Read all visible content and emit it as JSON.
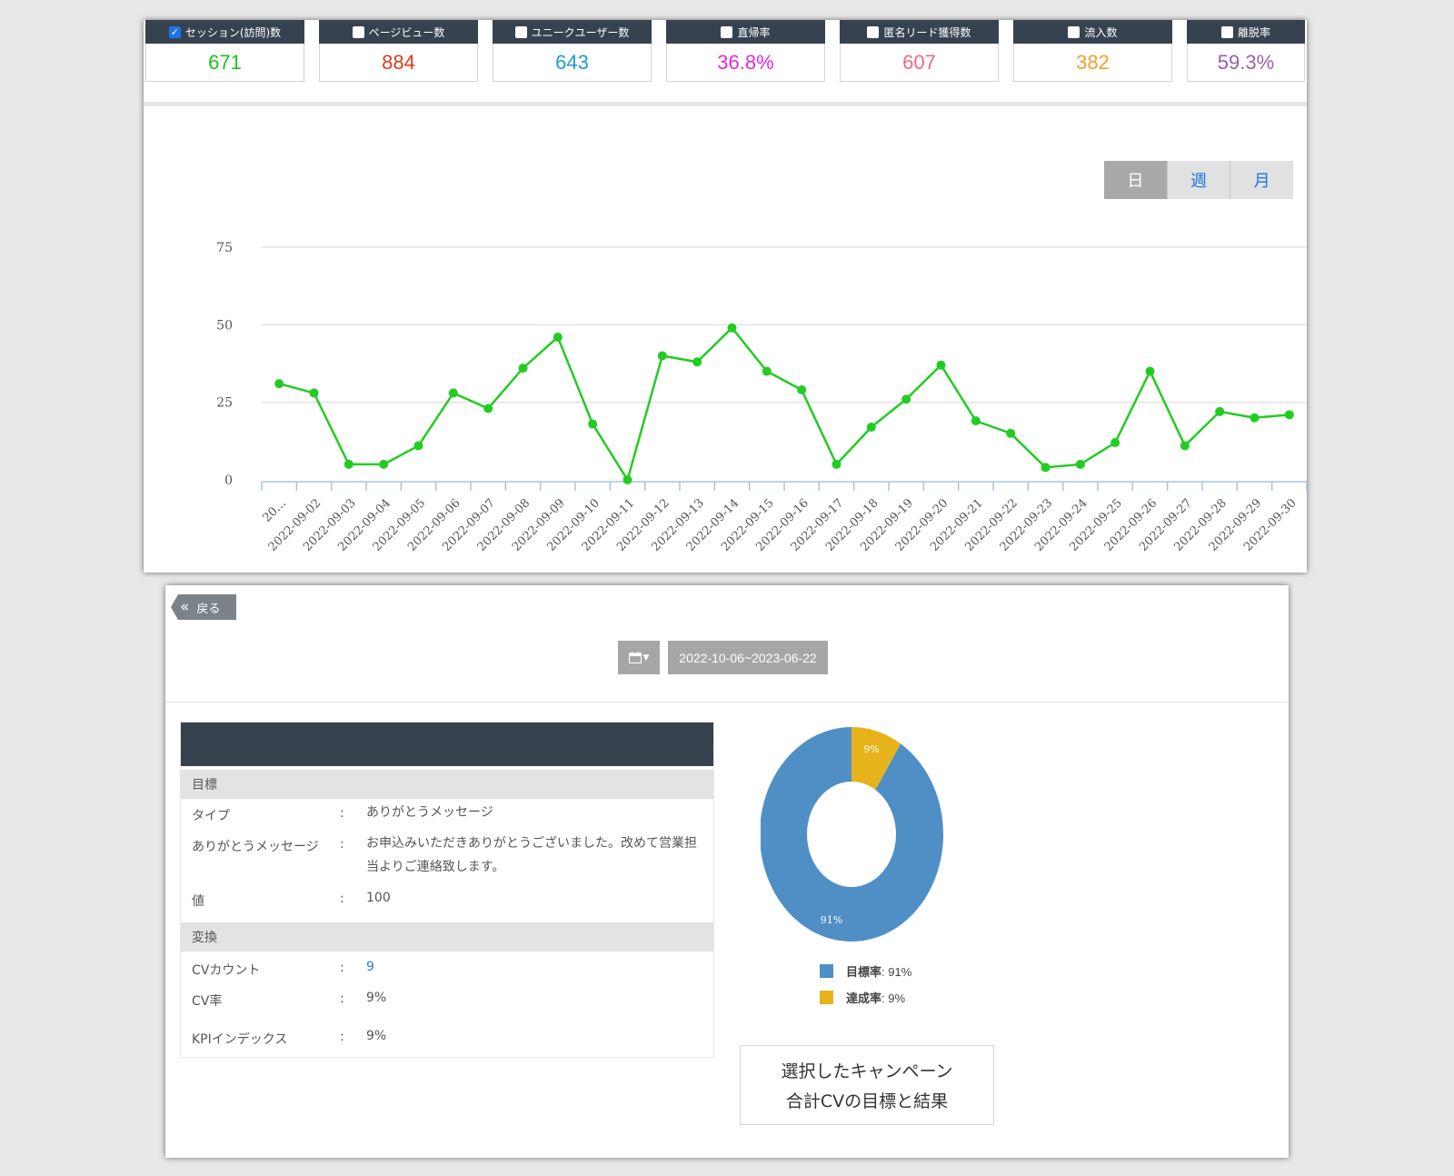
{
  "kpis": [
    {
      "label": "セッション(訪問)数",
      "value": "671",
      "color": "#22c01a",
      "checked": true
    },
    {
      "label": "ページビュー数",
      "value": "884",
      "color": "#e03a1e",
      "checked": false
    },
    {
      "label": "ユニークユーザー数",
      "value": "643",
      "color": "#1e9ad6",
      "checked": false
    },
    {
      "label": "直帰率",
      "value": "36.8%",
      "color": "#e52ad8",
      "checked": false
    },
    {
      "label": "匿名リード獲得数",
      "value": "607",
      "color": "#ee6a82",
      "checked": false
    },
    {
      "label": "流入数",
      "value": "382",
      "color": "#f2a028",
      "checked": false
    },
    {
      "label": "離脱率",
      "value": "59.3%",
      "color": "#9b5ea8",
      "checked": false
    }
  ],
  "period_toggle": {
    "day": "日",
    "week": "週",
    "month": "月"
  },
  "chart_data": {
    "type": "line",
    "x": [
      "20…",
      "2022-09-02",
      "2022-09-03",
      "2022-09-04",
      "2022-09-05",
      "2022-09-06",
      "2022-09-07",
      "2022-09-08",
      "2022-09-09",
      "2022-09-10",
      "2022-09-11",
      "2022-09-12",
      "2022-09-13",
      "2022-09-14",
      "2022-09-15",
      "2022-09-16",
      "2022-09-17",
      "2022-09-18",
      "2022-09-19",
      "2022-09-20",
      "2022-09-21",
      "2022-09-22",
      "2022-09-23",
      "2022-09-24",
      "2022-09-25",
      "2022-09-26",
      "2022-09-27",
      "2022-09-28",
      "2022-09-29",
      "2022-09-30"
    ],
    "series": [
      {
        "values": [
          31,
          28,
          5,
          5,
          11,
          28,
          23,
          36,
          46,
          18,
          0,
          40,
          38,
          49,
          35,
          29,
          5,
          17,
          26,
          37,
          19,
          15,
          4,
          5,
          12,
          35,
          11,
          22,
          20,
          21
        ],
        "color": "#22cc22"
      }
    ],
    "ylim": [
      0,
      75
    ],
    "yticks": [
      0,
      25,
      50,
      75
    ],
    "grid": true
  },
  "back_label": "戻る",
  "date_range": "2022-10-06~2023-06-22",
  "info": {
    "goal_section": "目標",
    "rows": [
      {
        "key": "タイプ",
        "colon": ":",
        "value": "ありがとうメッセージ"
      },
      {
        "key": "ありがとうメッセージ",
        "colon": ":",
        "value": "お申込みいただきありがとうございました。改めて営業担当よりご連絡致します。"
      },
      {
        "key": "値",
        "colon": ":",
        "value": "100"
      }
    ],
    "conv_section": "変換",
    "conv_rows": [
      {
        "key": "CVカウント",
        "colon": ":",
        "value": "9",
        "color": "#2a7fd4"
      },
      {
        "key": "CV率",
        "colon": ":",
        "value": "9%"
      },
      {
        "key": "KPIインデックス",
        "colon": ":",
        "value": "9%"
      }
    ]
  },
  "donut": {
    "slices": [
      {
        "name": "目標率",
        "value": 91,
        "label": "91%",
        "color": "#4f8fc6"
      },
      {
        "name": "達成率",
        "value": 9,
        "label": "9%",
        "color": "#e6b41a"
      }
    ],
    "legend": [
      {
        "label": "目標率",
        "value": ": 91%",
        "color": "#4f8fc6"
      },
      {
        "label": "達成率",
        "value": ": 9%",
        "color": "#e6b41a"
      }
    ]
  },
  "caption": {
    "line1": "選択したキャンペーン",
    "line2": "合計CVの目標と結果"
  }
}
